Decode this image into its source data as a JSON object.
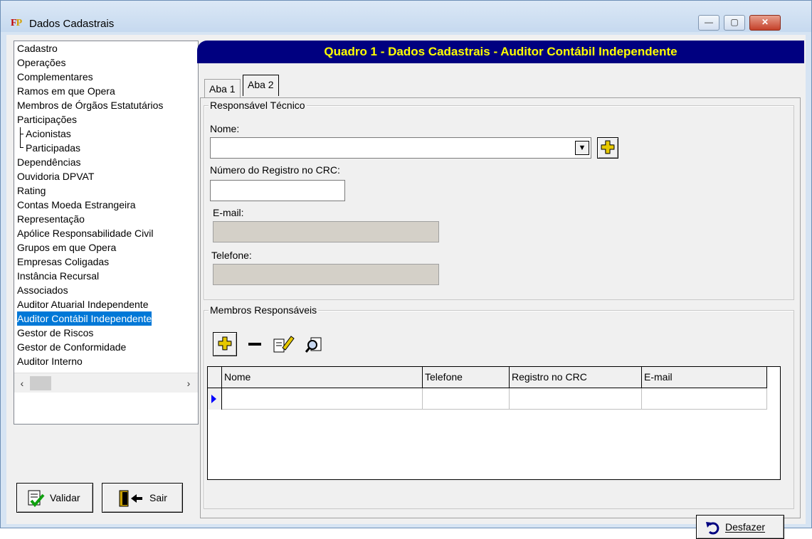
{
  "window": {
    "icon_text": "FP",
    "title": "Dados Cadastrais",
    "controls": {
      "minimize": "—",
      "maximize": "▢",
      "close": "✕"
    }
  },
  "tree": {
    "items": [
      {
        "label": "Cadastro",
        "level": 0,
        "selected": false
      },
      {
        "label": "Operações",
        "level": 0,
        "selected": false
      },
      {
        "label": "Complementares",
        "level": 0,
        "selected": false
      },
      {
        "label": "Ramos em que Opera",
        "level": 0,
        "selected": false
      },
      {
        "label": "Membros de Órgãos Estatutários",
        "level": 0,
        "selected": false
      },
      {
        "label": "Participações",
        "level": 0,
        "selected": false
      },
      {
        "label": "Acionistas",
        "level": 1,
        "selected": false
      },
      {
        "label": "Participadas",
        "level": 1,
        "selected": false
      },
      {
        "label": "Dependências",
        "level": 0,
        "selected": false
      },
      {
        "label": "Ouvidoria DPVAT",
        "level": 0,
        "selected": false
      },
      {
        "label": "Rating",
        "level": 0,
        "selected": false
      },
      {
        "label": "Contas Moeda Estrangeira",
        "level": 0,
        "selected": false
      },
      {
        "label": "Representação",
        "level": 0,
        "selected": false
      },
      {
        "label": "Apólice Responsabilidade Civil",
        "level": 0,
        "selected": false
      },
      {
        "label": "Grupos em que Opera",
        "level": 0,
        "selected": false
      },
      {
        "label": "Empresas Coligadas",
        "level": 0,
        "selected": false
      },
      {
        "label": "Instância Recursal",
        "level": 0,
        "selected": false
      },
      {
        "label": "Associados",
        "level": 0,
        "selected": false
      },
      {
        "label": "Auditor Atuarial Independente",
        "level": 0,
        "selected": false
      },
      {
        "label": "Auditor Contábil Independente",
        "level": 0,
        "selected": true
      },
      {
        "label": "Gestor de Riscos",
        "level": 0,
        "selected": false
      },
      {
        "label": "Gestor de Conformidade",
        "level": 0,
        "selected": false
      },
      {
        "label": "Auditor Interno",
        "level": 0,
        "selected": false
      }
    ]
  },
  "buttons": {
    "validar": "Validar",
    "sair": "Sair",
    "desfazer": "Desfazer"
  },
  "header": {
    "title": "Quadro 1 - Dados Cadastrais - Auditor Contábil Independente"
  },
  "tabs": [
    {
      "label": "Aba 1",
      "active": false
    },
    {
      "label": "Aba 2",
      "active": true
    }
  ],
  "responsavel": {
    "group_title": "Responsável Técnico",
    "nome_label": "Nome:",
    "nome_value": "",
    "crc_label": "Número do Registro no CRC:",
    "crc_value": "",
    "email_label": "E-mail:",
    "email_value": "",
    "telefone_label": "Telefone:",
    "telefone_value": ""
  },
  "membros": {
    "group_title": "Membros Responsáveis",
    "columns": [
      "Nome",
      "Telefone",
      "Registro no CRC",
      "E-mail"
    ]
  },
  "colors": {
    "header_bg": "#000080",
    "header_text": "#ffff00",
    "selection": "#0078d7"
  }
}
